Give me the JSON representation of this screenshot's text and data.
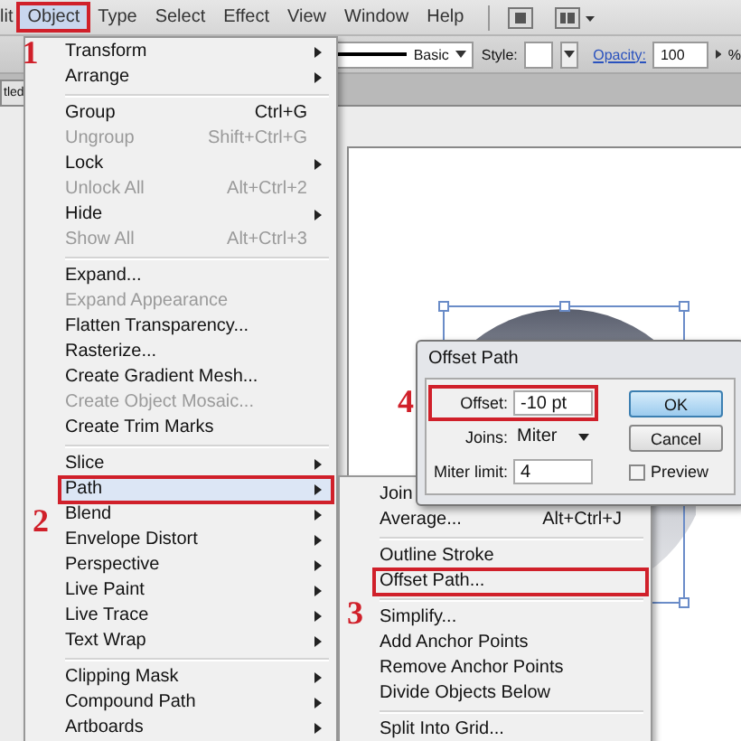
{
  "menubar": {
    "items": [
      {
        "label": "lit",
        "selected": false
      },
      {
        "label": "Object",
        "selected": true,
        "step": "1"
      },
      {
        "label": "Type",
        "selected": false
      },
      {
        "label": "Select",
        "selected": false
      },
      {
        "label": "Effect",
        "selected": false
      },
      {
        "label": "View",
        "selected": false
      },
      {
        "label": "Window",
        "selected": false
      },
      {
        "label": "Help",
        "selected": false
      }
    ]
  },
  "control_bar": {
    "stroke_profile": "Basic",
    "style_label": "Style:",
    "opacity_label": "Opacity:",
    "opacity_value": "100",
    "percent": "%"
  },
  "document_tab": "tled",
  "object_menu": {
    "sections": [
      [
        {
          "label": "Transform",
          "disabled": false,
          "submenu": true,
          "selected": false
        },
        {
          "label": "Arrange",
          "disabled": false,
          "submenu": true,
          "selected": false
        }
      ],
      [
        {
          "label": "Group",
          "shortcut": "Ctrl+G",
          "disabled": false,
          "submenu": false,
          "selected": false
        },
        {
          "label": "Ungroup",
          "shortcut": "Shift+Ctrl+G",
          "disabled": true,
          "submenu": false,
          "selected": false
        },
        {
          "label": "Lock",
          "disabled": false,
          "submenu": true,
          "selected": false
        },
        {
          "label": "Unlock All",
          "shortcut": "Alt+Ctrl+2",
          "disabled": true,
          "submenu": false,
          "selected": false
        },
        {
          "label": "Hide",
          "disabled": false,
          "submenu": true,
          "selected": false
        },
        {
          "label": "Show All",
          "shortcut": "Alt+Ctrl+3",
          "disabled": true,
          "submenu": false,
          "selected": false
        }
      ],
      [
        {
          "label": "Expand...",
          "disabled": false,
          "submenu": false,
          "selected": false
        },
        {
          "label": "Expand Appearance",
          "disabled": true,
          "submenu": false,
          "selected": false
        },
        {
          "label": "Flatten Transparency...",
          "disabled": false,
          "submenu": false,
          "selected": false
        },
        {
          "label": "Rasterize...",
          "disabled": false,
          "submenu": false,
          "selected": false
        },
        {
          "label": "Create Gradient Mesh...",
          "disabled": false,
          "submenu": false,
          "selected": false
        },
        {
          "label": "Create Object Mosaic...",
          "disabled": true,
          "submenu": false,
          "selected": false
        },
        {
          "label": "Create Trim Marks",
          "disabled": false,
          "submenu": false,
          "selected": false
        }
      ],
      [
        {
          "label": "Slice",
          "disabled": false,
          "submenu": true,
          "selected": false
        },
        {
          "label": "Path",
          "disabled": false,
          "submenu": true,
          "selected": true,
          "step": "2"
        },
        {
          "label": "Blend",
          "disabled": false,
          "submenu": true,
          "selected": false
        },
        {
          "label": "Envelope Distort",
          "disabled": false,
          "submenu": true,
          "selected": false
        },
        {
          "label": "Perspective",
          "disabled": false,
          "submenu": true,
          "selected": false
        },
        {
          "label": "Live Paint",
          "disabled": false,
          "submenu": true,
          "selected": false
        },
        {
          "label": "Live Trace",
          "disabled": false,
          "submenu": true,
          "selected": false
        },
        {
          "label": "Text Wrap",
          "disabled": false,
          "submenu": true,
          "selected": false
        }
      ],
      [
        {
          "label": "Clipping Mask",
          "disabled": false,
          "submenu": true,
          "selected": false
        },
        {
          "label": "Compound Path",
          "disabled": false,
          "submenu": true,
          "selected": false
        },
        {
          "label": "Artboards",
          "disabled": false,
          "submenu": true,
          "selected": false
        }
      ]
    ]
  },
  "path_submenu": {
    "sections": [
      [
        {
          "label": "Join",
          "disabled": false,
          "selected": false
        },
        {
          "label": "Average...",
          "shortcut": "Alt+Ctrl+J",
          "disabled": false,
          "selected": false
        }
      ],
      [
        {
          "label": "Outline Stroke",
          "disabled": false,
          "selected": false
        },
        {
          "label": "Offset Path...",
          "disabled": false,
          "selected": false,
          "step": "3"
        }
      ],
      [
        {
          "label": "Simplify...",
          "disabled": false,
          "selected": false
        },
        {
          "label": "Add Anchor Points",
          "disabled": false,
          "selected": false
        },
        {
          "label": "Remove Anchor Points",
          "disabled": false,
          "selected": false
        },
        {
          "label": "Divide Objects Below",
          "disabled": false,
          "selected": false
        }
      ],
      [
        {
          "label": "Split Into Grid...",
          "disabled": false,
          "selected": false
        }
      ]
    ]
  },
  "dialog": {
    "title": "Offset Path",
    "offset_label": "Offset:",
    "offset_value": "-10 pt",
    "offset_step": "4",
    "joins_label": "Joins:",
    "joins_value": "Miter",
    "miter_limit_label": "Miter limit:",
    "miter_limit_value": "4",
    "ok": "OK",
    "cancel": "Cancel",
    "preview_label": "Preview",
    "preview_checked": false
  }
}
